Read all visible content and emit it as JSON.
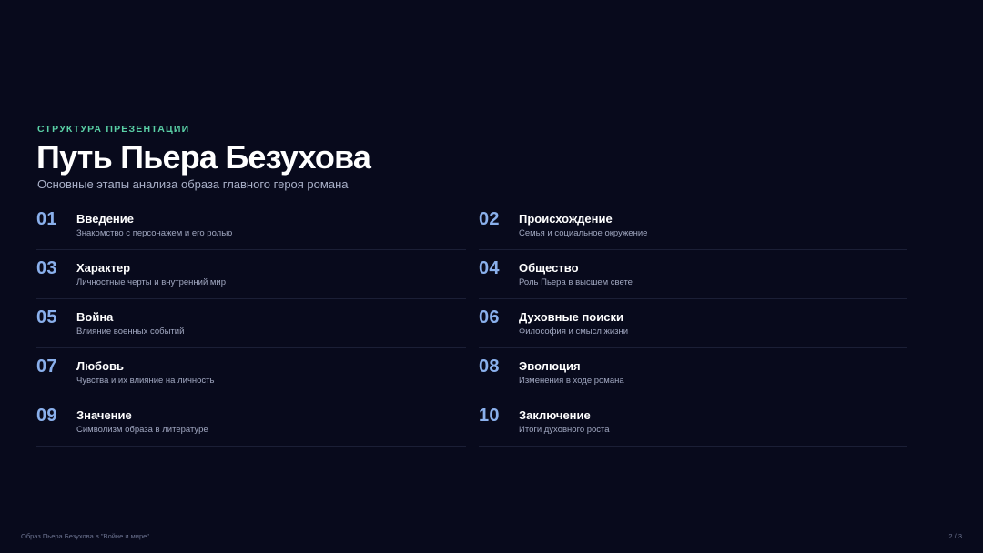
{
  "header": {
    "eyebrow": "СТРУКТУРА ПРЕЗЕНТАЦИИ",
    "title": "Путь Пьера Безухова",
    "subtitle": "Основные этапы анализа образа главного героя романа"
  },
  "items": [
    {
      "num": "01",
      "title": "Введение",
      "desc": "Знакомство с персонажем и его ролью"
    },
    {
      "num": "02",
      "title": "Происхождение",
      "desc": "Семья и социальное окружение"
    },
    {
      "num": "03",
      "title": "Характер",
      "desc": "Личностные черты и внутренний мир"
    },
    {
      "num": "04",
      "title": "Общество",
      "desc": "Роль Пьера в высшем свете"
    },
    {
      "num": "05",
      "title": "Война",
      "desc": "Влияние военных событий"
    },
    {
      "num": "06",
      "title": "Духовные поиски",
      "desc": "Философия и смысл жизни"
    },
    {
      "num": "07",
      "title": "Любовь",
      "desc": "Чувства и их влияние на личность"
    },
    {
      "num": "08",
      "title": "Эволюция",
      "desc": "Изменения в ходе романа"
    },
    {
      "num": "09",
      "title": "Значение",
      "desc": "Символизм образа в литературе"
    },
    {
      "num": "10",
      "title": "Заключение",
      "desc": "Итоги духовного роста"
    }
  ],
  "footer": {
    "left": "Образ Пьера Безухова в \"Войне и мире\"",
    "right": "2 / 3"
  },
  "colors": {
    "background": "#080a1c",
    "accent_eyebrow": "#5ad0a6",
    "accent_number": "#8ab0ec"
  }
}
